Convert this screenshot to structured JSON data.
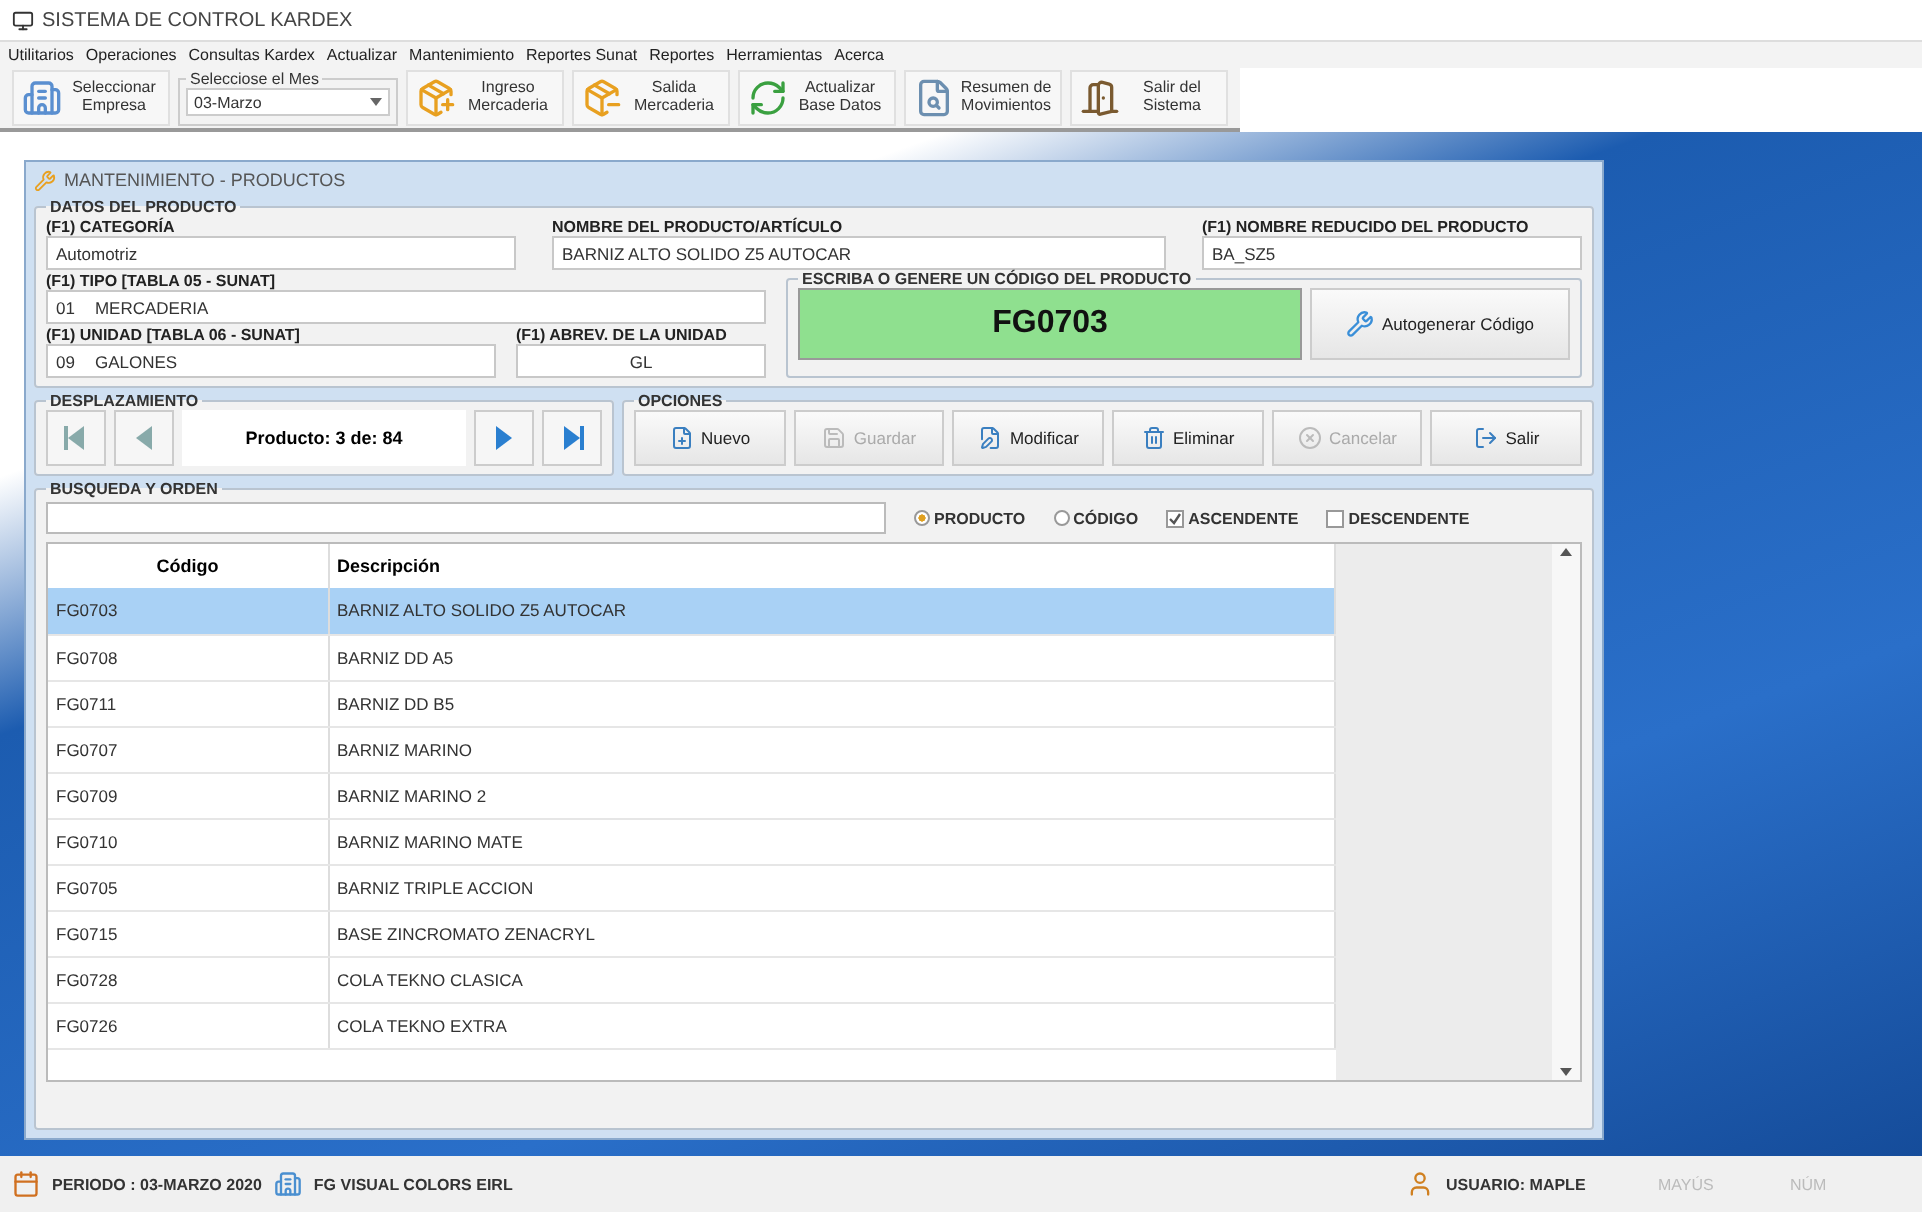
{
  "window": {
    "title": "SISTEMA DE CONTROL KARDEX"
  },
  "menu": [
    "Utilitarios",
    "Operaciones",
    "Consultas Kardex",
    "Actualizar",
    "Mantenimiento",
    "Reportes Sunat",
    "Reportes",
    "Herramientas",
    "Acerca"
  ],
  "toolbar": {
    "items": [
      {
        "kind": "button",
        "label": "Seleccionar Empresa"
      },
      {
        "kind": "combo",
        "legend": "Selecciose el Mes",
        "value": "03-Marzo"
      },
      {
        "kind": "button",
        "label": "Ingreso Mercaderia"
      },
      {
        "kind": "button",
        "label": "Salida Mercaderia"
      },
      {
        "kind": "button",
        "label": "Actualizar Base Datos"
      },
      {
        "kind": "button",
        "label": "Resumen de Movimientos"
      },
      {
        "kind": "button",
        "label": "Salir del Sistema"
      }
    ]
  },
  "child_window": {
    "title": "MANTENIMIENTO - PRODUCTOS",
    "product_data": {
      "legend": "DATOS DEL PRODUCTO",
      "category": {
        "label": "(F1) CATEGORÍA",
        "value": "Automotriz"
      },
      "name": {
        "label": "NOMBRE DEL PRODUCTO/ARTÍCULO",
        "value": "BARNIZ ALTO SOLIDO Z5 AUTOCAR"
      },
      "short_name": {
        "label": "(F1) NOMBRE REDUCIDO DEL PRODUCTO",
        "value": "BA_SZ5"
      },
      "type": {
        "label": "(F1) TIPO [TABLA 05 - SUNAT]",
        "code": "01",
        "value": "MERCADERIA"
      },
      "unit": {
        "label": "(F1) UNIDAD [TABLA 06 - SUNAT]",
        "code": "09",
        "value": "GALONES"
      },
      "unit_abbrev": {
        "label": "(F1) ABREV. DE LA UNIDAD",
        "value": "GL"
      },
      "code_box": {
        "legend": "ESCRIBA O GENERE UN CÓDIGO DEL PRODUCTO",
        "value": "FG0703",
        "button": "Autogenerar Código"
      }
    },
    "navigation": {
      "legend": "DESPLAZAMIENTO",
      "position": "Producto: 3 de: 84"
    },
    "options": {
      "legend": "OPCIONES",
      "buttons": [
        {
          "label": "Nuevo",
          "disabled": false
        },
        {
          "label": "Guardar",
          "disabled": true
        },
        {
          "label": "Modificar",
          "disabled": false
        },
        {
          "label": "Eliminar",
          "disabled": false
        },
        {
          "label": "Cancelar",
          "disabled": true
        },
        {
          "label": "Salir",
          "disabled": false
        }
      ]
    },
    "search": {
      "legend": "BUSQUEDA Y ORDEN",
      "radios": [
        {
          "label": "PRODUCTO",
          "selected": true
        },
        {
          "label": "CÓDIGO",
          "selected": false
        }
      ],
      "checks": [
        {
          "label": "ASCENDENTE",
          "checked": true
        },
        {
          "label": "DESCENDENTE",
          "checked": false
        }
      ]
    },
    "table": {
      "columns": [
        "Código",
        "Descripción"
      ],
      "rows": [
        {
          "code": "FG0703",
          "description": "BARNIZ ALTO SOLIDO Z5 AUTOCAR",
          "selected": true
        },
        {
          "code": "FG0708",
          "description": "BARNIZ DD A5",
          "selected": false
        },
        {
          "code": "FG0711",
          "description": "BARNIZ DD B5",
          "selected": false
        },
        {
          "code": "FG0707",
          "description": "BARNIZ MARINO",
          "selected": false
        },
        {
          "code": "FG0709",
          "description": "BARNIZ MARINO 2",
          "selected": false
        },
        {
          "code": "FG0710",
          "description": "BARNIZ MARINO MATE",
          "selected": false
        },
        {
          "code": "FG0705",
          "description": "BARNIZ TRIPLE ACCION",
          "selected": false
        },
        {
          "code": "FG0715",
          "description": "BASE ZINCROMATO ZENACRYL",
          "selected": false
        },
        {
          "code": "FG0728",
          "description": "COLA TEKNO CLASICA",
          "selected": false
        },
        {
          "code": "FG0726",
          "description": "COLA TEKNO EXTRA",
          "selected": false
        }
      ]
    }
  },
  "status_bar": {
    "period": "PERIODO : 03-MARZO 2020",
    "company": "FG VISUAL COLORS EIRL",
    "user": "USUARIO: MAPLE",
    "indicators": [
      {
        "label": "MAYÚS",
        "active": false
      },
      {
        "label": "NÚM",
        "active": false
      }
    ]
  }
}
